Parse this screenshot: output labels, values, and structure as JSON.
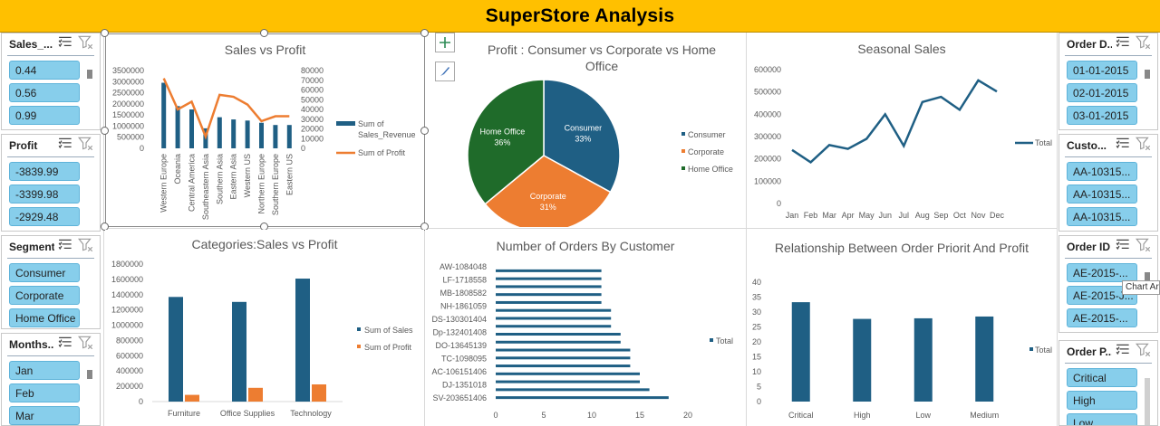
{
  "dashboard_title": "SuperStore Analysis",
  "colors": {
    "title_bar": "#FFC000",
    "blue": "#1F5F84",
    "orange": "#ED7D31",
    "green": "#1F6B2A",
    "slicer_item": "#87CEEB"
  },
  "slicers": {
    "sales": {
      "title": "Sales_...",
      "items": [
        "0.44",
        "0.56",
        "0.99"
      ]
    },
    "profit": {
      "title": "Profit",
      "items": [
        "-3839.99",
        "-3399.98",
        "-2929.48"
      ]
    },
    "segment": {
      "title": "Segment",
      "items": [
        "Consumer",
        "Corporate",
        "Home Office"
      ]
    },
    "months": {
      "title": "Months...",
      "items": [
        "Jan",
        "Feb",
        "Mar"
      ]
    },
    "order_date": {
      "title": "Order D...",
      "items": [
        "01-01-2015",
        "02-01-2015",
        "03-01-2015"
      ]
    },
    "customer": {
      "title": "Custo...",
      "items": [
        "AA-10315...",
        "AA-10315...",
        "AA-10315..."
      ]
    },
    "order_id": {
      "title": "Order ID",
      "items": [
        "AE-2015-...",
        "AE-2015-J...",
        "AE-2015-..."
      ]
    },
    "order_priority": {
      "title": "Order P...",
      "items": [
        "Critical",
        "High",
        "Low"
      ]
    }
  },
  "tooltip": "Chart Ar",
  "chart_data": [
    {
      "id": "sales_vs_profit",
      "type": "bar",
      "title": "Sales vs Profit",
      "categories": [
        "Western Europe",
        "Oceania",
        "Central America",
        "Southeastern Asia",
        "Southern Asia",
        "Eastern Asia",
        "Western US",
        "Northern Europe",
        "Southern Europe",
        "Eastern US"
      ],
      "series": [
        {
          "name": "Sum of Sales_Revenue",
          "type": "bar",
          "axis": "left",
          "values": [
            2950000,
            1900000,
            1750000,
            900000,
            1400000,
            1300000,
            1250000,
            1150000,
            1050000,
            1050000
          ]
        },
        {
          "name": "Sum of Profit",
          "type": "line",
          "axis": "right",
          "values": [
            72000,
            40000,
            48000,
            12000,
            55000,
            53000,
            45000,
            28000,
            33000,
            33000
          ]
        }
      ],
      "left_ticks": [
        "0",
        "500000",
        "1000000",
        "1500000",
        "2000000",
        "2500000",
        "3000000",
        "3500000"
      ],
      "right_ticks": [
        "0",
        "10000",
        "20000",
        "30000",
        "40000",
        "50000",
        "60000",
        "70000",
        "80000"
      ],
      "ylim_left": [
        0,
        3500000
      ],
      "ylim_right": [
        0,
        80000
      ],
      "legend": "right"
    },
    {
      "id": "profit_segment_pie",
      "type": "pie",
      "title": "Profit : Consumer vs Corporate vs Home Office",
      "categories": [
        "Consumer",
        "Corporate",
        "Home Office"
      ],
      "values": [
        33,
        31,
        36
      ],
      "labels": [
        "33%",
        "31%",
        "36%"
      ],
      "legend": "right"
    },
    {
      "id": "seasonal_sales",
      "type": "line",
      "title": "Seasonal Sales",
      "categories": [
        "Jan",
        "Feb",
        "Mar",
        "Apr",
        "May",
        "Jun",
        "Jul",
        "Aug",
        "Sep",
        "Oct",
        "Nov",
        "Dec"
      ],
      "series": [
        {
          "name": "Total",
          "values": [
            240000,
            185000,
            262000,
            245000,
            290000,
            400000,
            258000,
            455000,
            478000,
            420000,
            552000,
            502000
          ]
        }
      ],
      "y_ticks": [
        "0",
        "100000",
        "200000",
        "300000",
        "400000",
        "500000",
        "600000"
      ],
      "ylim": [
        0,
        600000
      ],
      "legend": "right"
    },
    {
      "id": "categories_sales_profit",
      "type": "bar",
      "title": "Categories:Sales vs Profit",
      "categories": [
        "Furniture",
        "Office Supplies",
        "Technology"
      ],
      "series": [
        {
          "name": "Sum of Sales",
          "values": [
            1370000,
            1305000,
            1610000
          ]
        },
        {
          "name": "Sum of Profit",
          "values": [
            88000,
            180000,
            225000
          ]
        }
      ],
      "y_ticks": [
        "0",
        "200000",
        "400000",
        "600000",
        "800000",
        "1000000",
        "1200000",
        "1400000",
        "1600000",
        "1800000"
      ],
      "ylim": [
        0,
        1800000
      ],
      "legend": "right"
    },
    {
      "id": "orders_by_customer",
      "type": "bar",
      "orientation": "horizontal",
      "title": "Number of Orders By Customer",
      "categories": [
        "AW-1084048",
        "LF-1718558",
        "MB-1808582",
        "NH-1861059",
        "DS-130301404",
        "Dp-132401408",
        "DO-13645139",
        "TC-1098095",
        "AC-106151406",
        "DJ-1351018",
        "SV-203651406"
      ],
      "series": [
        {
          "name": "Total",
          "values": [
            11,
            11,
            11,
            11,
            11,
            12,
            12,
            12,
            13,
            13,
            14,
            14,
            14,
            15,
            15,
            16,
            18
          ]
        }
      ],
      "x_ticks": [
        "0",
        "5",
        "10",
        "15",
        "20"
      ],
      "xlim": [
        0,
        20
      ],
      "legend": "right"
    },
    {
      "id": "order_priority_profit",
      "type": "bar",
      "title": "Relationship Between Order Priorit And Profit",
      "categories": [
        "Critical",
        "High",
        "Low",
        "Medium"
      ],
      "series": [
        {
          "name": "Total",
          "values": [
            33.3,
            27.7,
            27.9,
            28.5
          ]
        }
      ],
      "y_ticks": [
        "0",
        "5",
        "10",
        "15",
        "20",
        "25",
        "30",
        "35",
        "40"
      ],
      "ylim": [
        0,
        40
      ],
      "legend": "right"
    }
  ]
}
